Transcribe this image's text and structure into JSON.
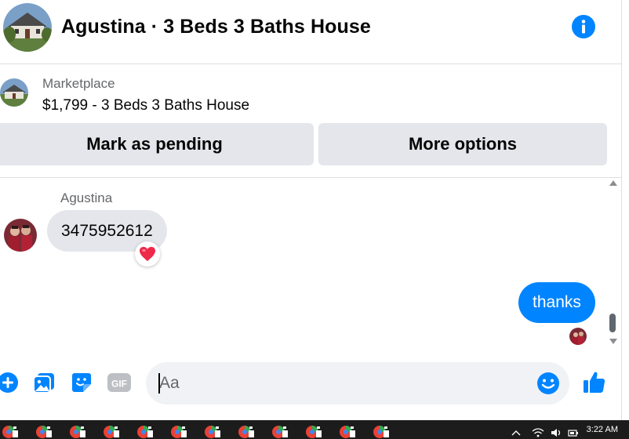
{
  "header": {
    "title": "Agustina · 3 Beds 3 Baths House"
  },
  "listing": {
    "source": "Marketplace",
    "title": "$1,799 - 3 Beds 3 Baths House"
  },
  "actions": {
    "pending_label": "Mark as pending",
    "more_label": "More options"
  },
  "conversation": {
    "sender_name": "Agustina",
    "incoming_text": "3475952612",
    "incoming_reaction": "heart",
    "outgoing_text": "thanks"
  },
  "composer": {
    "placeholder": "Aa",
    "icons": [
      "plus-circle-icon",
      "photo-icon",
      "sticker-icon",
      "gif-icon",
      "emoji-icon",
      "thumbs-up-icon"
    ],
    "gif_label": "GIF"
  },
  "taskbar": {
    "clock": "3:22 AM"
  },
  "colors": {
    "accent": "#0084ff",
    "bubble_in": "#e4e6eb",
    "muted_text": "#65676b"
  }
}
